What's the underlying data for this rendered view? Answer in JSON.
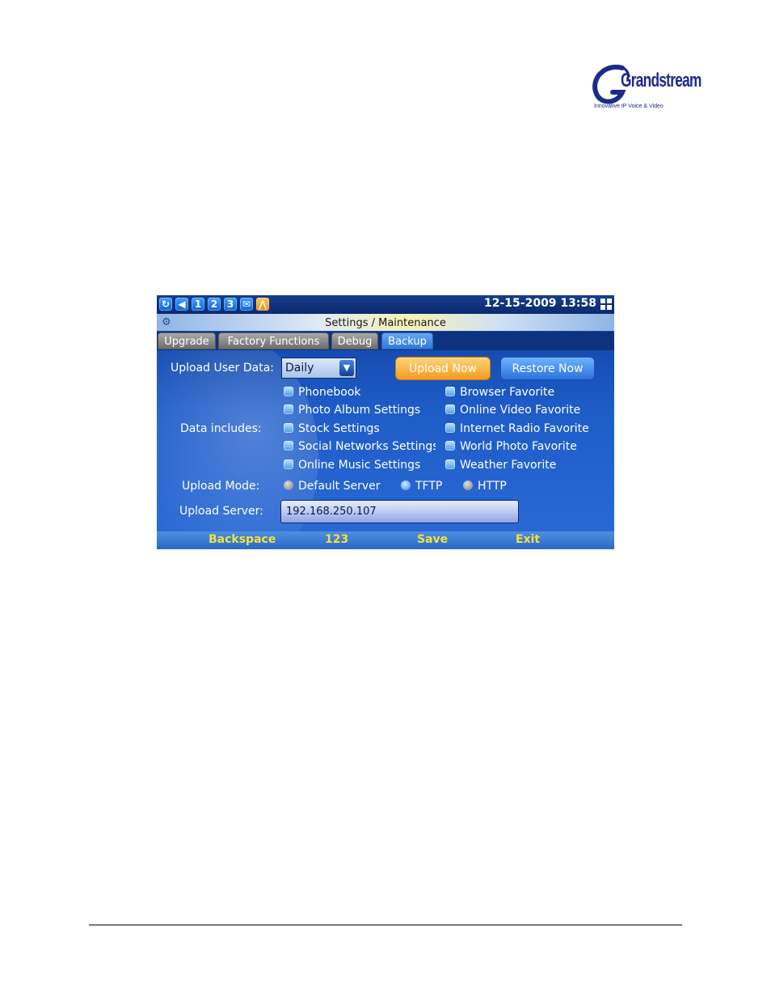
{
  "logo": {
    "brand": "Grandstream",
    "tagline": "Innovative IP Voice & Video"
  },
  "status_bar": {
    "icons": [
      {
        "name": "refresh-icon",
        "glyph": "↻"
      },
      {
        "name": "volume-icon",
        "glyph": "◀"
      },
      {
        "name": "line-1-icon",
        "glyph": "1"
      },
      {
        "name": "line-2-icon",
        "glyph": "2"
      },
      {
        "name": "line-3-icon",
        "glyph": "3"
      },
      {
        "name": "message-icon",
        "glyph": "✉"
      },
      {
        "name": "network-icon",
        "glyph": "⋀"
      }
    ],
    "datetime": "12-15-2009 13:58"
  },
  "title": "Settings / Maintenance",
  "tabs": [
    {
      "label": "Upgrade",
      "active": false
    },
    {
      "label": "Factory Functions",
      "active": false
    },
    {
      "label": "Debug",
      "active": false
    },
    {
      "label": "Backup",
      "active": true
    }
  ],
  "form": {
    "upload_user_data_label": "Upload User Data:",
    "upload_user_data_value": "Daily",
    "upload_now": "Upload Now",
    "restore_now": "Restore Now",
    "data_includes_label": "Data includes:",
    "data_items_left": [
      "Phonebook",
      "Photo Album Settings",
      "Stock Settings",
      "Social Networks Settings",
      "Online Music Settings"
    ],
    "data_items_right": [
      "Browser Favorite",
      "Online Video Favorite",
      "Internet Radio Favorite",
      "World Photo Favorite",
      "Weather Favorite"
    ],
    "upload_mode_label": "Upload Mode:",
    "upload_modes": [
      "Default Server",
      "TFTP",
      "HTTP"
    ],
    "upload_server_label": "Upload Server:",
    "upload_server_value": "192.168.250.107"
  },
  "softkeys": [
    "Backspace",
    "123",
    "Save",
    "Exit"
  ],
  "colors": {
    "accent_orange": "#f59a1e",
    "accent_blue": "#2a72da",
    "softkey_text": "#f3e23a",
    "screen_bg": "#1e5cc8"
  }
}
